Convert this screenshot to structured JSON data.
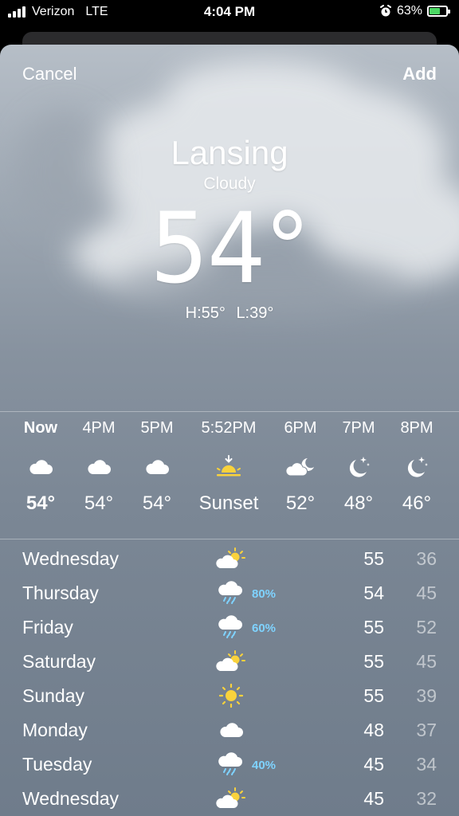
{
  "status": {
    "carrier": "Verizon",
    "network": "LTE",
    "time": "4:04 PM",
    "battery": "63%",
    "battery_level": 0.63
  },
  "nav": {
    "cancel": "Cancel",
    "add": "Add"
  },
  "current": {
    "city": "Lansing",
    "condition": "Cloudy",
    "temp": "54°",
    "high": "H:55°",
    "low": "L:39°"
  },
  "hourly": [
    {
      "label": "Now",
      "icon": "cloud-icon",
      "temp": "54°"
    },
    {
      "label": "4PM",
      "icon": "cloud-icon",
      "temp": "54°"
    },
    {
      "label": "5PM",
      "icon": "cloud-icon",
      "temp": "54°"
    },
    {
      "label": "5:52PM",
      "icon": "sunset-icon",
      "temp": "Sunset"
    },
    {
      "label": "6PM",
      "icon": "cloud-moon-icon",
      "temp": "52°"
    },
    {
      "label": "7PM",
      "icon": "moon-stars-icon",
      "temp": "48°"
    },
    {
      "label": "8PM",
      "icon": "moon-stars-icon",
      "temp": "46°"
    }
  ],
  "daily": [
    {
      "day": "Wednesday",
      "icon": "partly-cloudy-icon",
      "precip": "",
      "hi": "55",
      "lo": "36"
    },
    {
      "day": "Thursday",
      "icon": "rain-icon",
      "precip": "80%",
      "hi": "54",
      "lo": "45"
    },
    {
      "day": "Friday",
      "icon": "rain-icon",
      "precip": "60%",
      "hi": "55",
      "lo": "52"
    },
    {
      "day": "Saturday",
      "icon": "partly-cloudy-icon",
      "precip": "",
      "hi": "55",
      "lo": "45"
    },
    {
      "day": "Sunday",
      "icon": "sun-icon",
      "precip": "",
      "hi": "55",
      "lo": "39"
    },
    {
      "day": "Monday",
      "icon": "cloud-icon",
      "precip": "",
      "hi": "48",
      "lo": "37"
    },
    {
      "day": "Tuesday",
      "icon": "rain-icon",
      "precip": "40%",
      "hi": "45",
      "lo": "34"
    },
    {
      "day": "Wednesday",
      "icon": "partly-cloudy-icon",
      "precip": "",
      "hi": "45",
      "lo": "32"
    }
  ],
  "colors": {
    "precip": "#7fd3ff",
    "sun": "#f9d23c",
    "sheet_top": "#b6bec7",
    "sheet_bottom": "#6f7c8b"
  }
}
